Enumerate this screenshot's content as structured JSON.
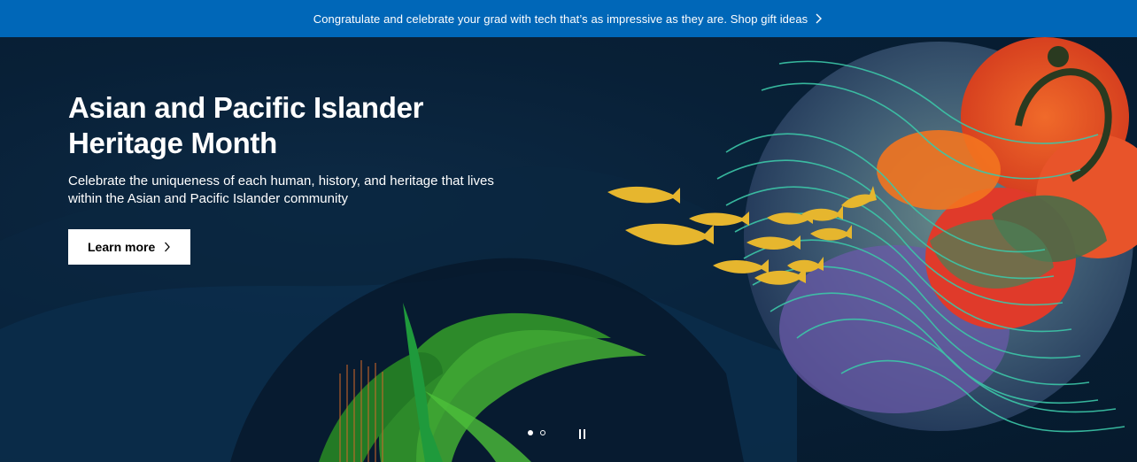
{
  "banner": {
    "text": "Congratulate and celebrate your grad with tech that’s as impressive as they are. Shop gift ideas",
    "icon": "chevron-right-icon"
  },
  "hero": {
    "title": "Asian and Pacific Islander Heritage Month",
    "subtitle": "Celebrate the uniqueness of each human, history, and heritage that lives within the Asian and Pacific Islander community",
    "cta_label": "Learn more",
    "cta_icon": "chevron-right-icon"
  },
  "carousel": {
    "slides": 2,
    "active_slide": 1,
    "pause_icon": "pause-icon"
  },
  "colors": {
    "banner_bg": "#0067b8",
    "hero_bg": "#082037",
    "cta_bg": "#ffffff"
  }
}
